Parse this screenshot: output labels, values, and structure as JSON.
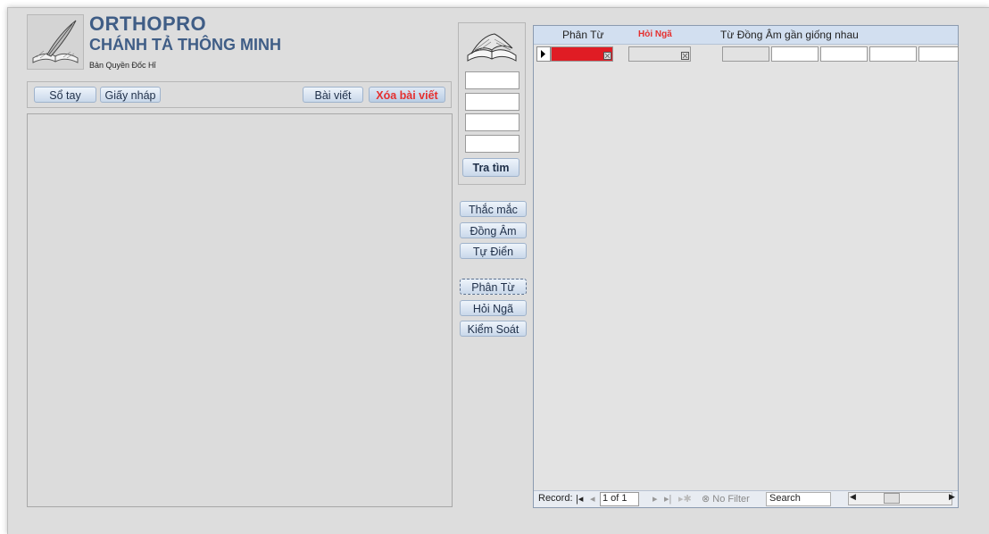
{
  "header": {
    "title": "ORTHOPRO",
    "subtitle": "CHÁNH TẢ THÔNG MINH",
    "copyright": "Bản Quyền Đốc Hỉ"
  },
  "toolbar": {
    "notebook": "Sổ tay",
    "draft": "Giấy nháp",
    "article": "Bài viết",
    "delete_article": "Xóa bài viết"
  },
  "search": {
    "button": "Tra tìm"
  },
  "side_buttons": {
    "questions": "Thắc mắc",
    "homophone": "Đồng Âm",
    "dictionary": "Tự Điển",
    "analyze": "Phân Từ",
    "hoi_nga": "Hỏi Ngã",
    "control": "Kiểm Soát"
  },
  "grid": {
    "columns": {
      "phan_tu": "Phân Từ",
      "hoi_nga": "Hỏi Ngã",
      "dong_am": "Từ Đồng Âm gần giống nhau"
    }
  },
  "record_nav": {
    "label": "Record:",
    "first": "◂",
    "prev": "◂",
    "position": "1 of 1",
    "next": "▸",
    "last": "▸",
    "filter": "No Filter",
    "search": "Search"
  },
  "colors": {
    "title": "#3f5d86",
    "accent_red": "#e5302f",
    "cell_red": "#e01c24"
  }
}
